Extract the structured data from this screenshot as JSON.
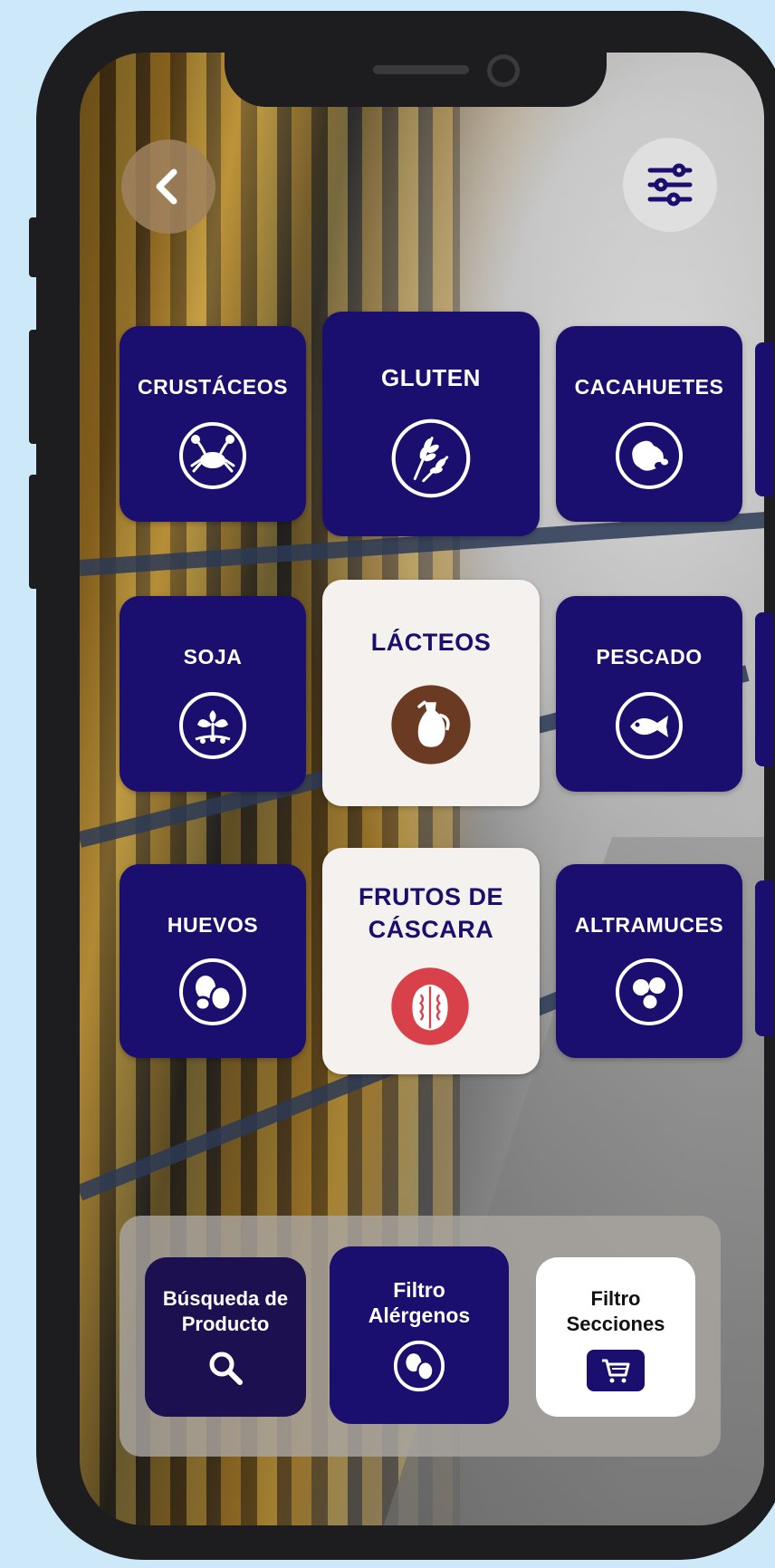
{
  "nav": {
    "back_icon": "chevron-left-icon",
    "filter_icon": "sliders-icon"
  },
  "allergens": [
    {
      "label": "CRUSTÁCEOS",
      "icon": "crab-icon",
      "selected": false
    },
    {
      "label": "GLUTEN",
      "icon": "wheat-icon",
      "selected": false
    },
    {
      "label": "CACAHUETES",
      "icon": "peanut-icon",
      "selected": false
    },
    {
      "label": "SOJA",
      "icon": "soy-plant-icon",
      "selected": false
    },
    {
      "label": "LÁCTEOS",
      "icon": "milk-jug-icon",
      "selected": true
    },
    {
      "label": "PESCADO",
      "icon": "fish-icon",
      "selected": false
    },
    {
      "label": "HUEVOS",
      "icon": "eggs-icon",
      "selected": false
    },
    {
      "label": "FRUTOS DE CÁSCARA",
      "label_line1": "FRUTOS DE",
      "label_line2": "CÁSCARA",
      "icon": "walnut-icon",
      "selected": true
    },
    {
      "label": "ALTRAMUCES",
      "icon": "lupin-icon",
      "selected": false
    }
  ],
  "bottom_bar": {
    "search": {
      "line1": "Búsqueda de",
      "line2": "Producto",
      "icon": "search-icon"
    },
    "allergen_filter": {
      "line1": "Filtro",
      "line2": "Alérgenos",
      "icon": "allergen-icon"
    },
    "section_filter": {
      "line1": "Filtro",
      "line2": "Secciones",
      "icon": "cart-icon"
    }
  },
  "colors": {
    "tile_navy": "#1a0f6e",
    "selected_bg": "#f4f1ee",
    "milk_brown": "#6b3a22",
    "nut_red": "#d9414a"
  }
}
